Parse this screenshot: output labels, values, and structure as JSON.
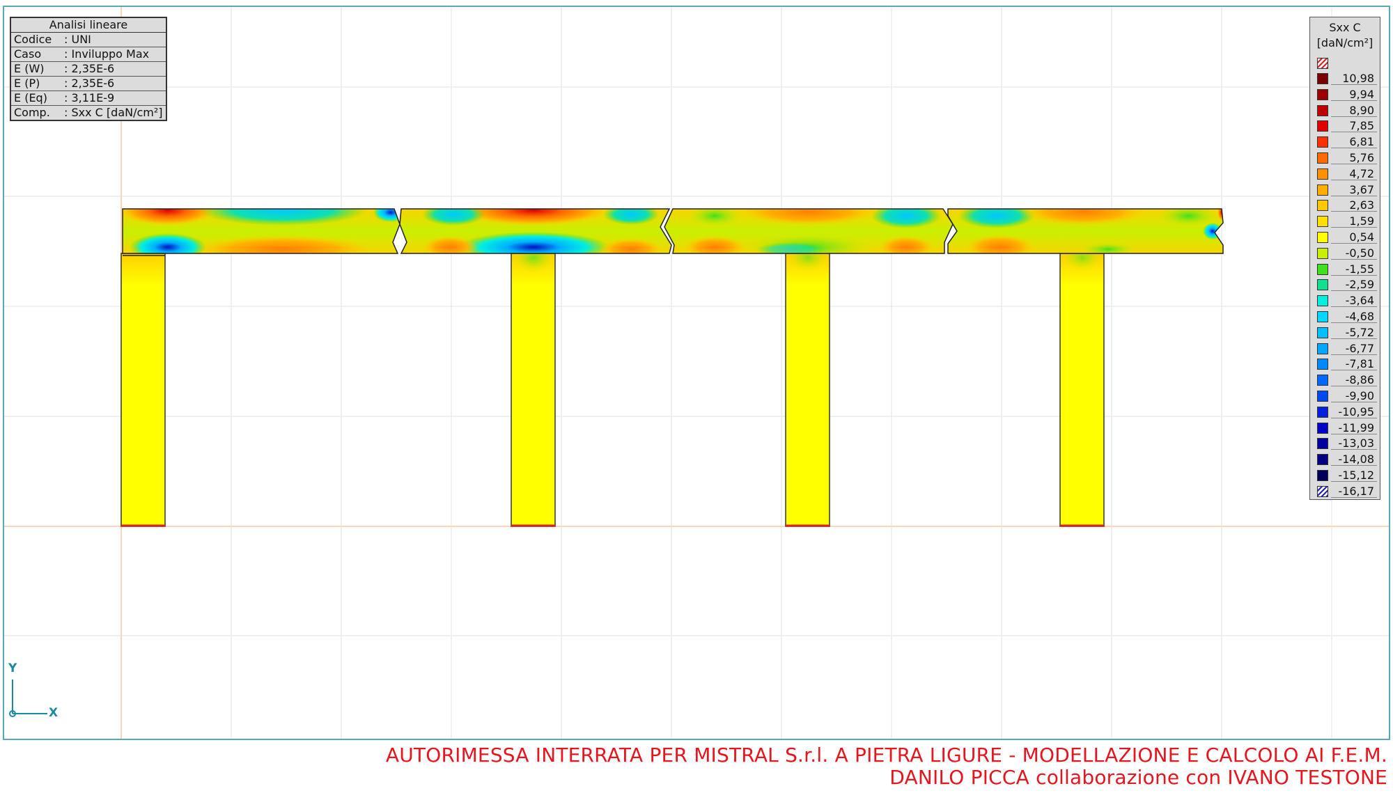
{
  "info_panel": {
    "title": "Analisi lineare",
    "rows": [
      {
        "key": "Codice",
        "value": ": UNI"
      },
      {
        "key": "Caso",
        "value": ": Inviluppo Max"
      },
      {
        "key": "E (W)",
        "value": ": 2,35E-6"
      },
      {
        "key": "E (P)",
        "value": ": 2,35E-6"
      },
      {
        "key": "E (Eq)",
        "value": ": 3,11E-9"
      },
      {
        "key": "Comp.",
        "value": ": Sxx C [daN/cm²]"
      }
    ]
  },
  "legend": {
    "title": "Sxx C",
    "unit": "[daN/cm²]",
    "entries": [
      {
        "label": "10,98",
        "color": "#7a0000"
      },
      {
        "label": "9,94",
        "color": "#9e0000"
      },
      {
        "label": "8,90",
        "color": "#c00000"
      },
      {
        "label": "7,85",
        "color": "#e00000"
      },
      {
        "label": "6,81",
        "color": "#ff3000"
      },
      {
        "label": "5,76",
        "color": "#ff6a00"
      },
      {
        "label": "4,72",
        "color": "#ff9000"
      },
      {
        "label": "3,67",
        "color": "#ffae00"
      },
      {
        "label": "2,63",
        "color": "#ffc800"
      },
      {
        "label": "1,59",
        "color": "#ffe000"
      },
      {
        "label": "0,54",
        "color": "#ffff00"
      },
      {
        "label": "-0,50",
        "color": "#c8f000"
      },
      {
        "label": "-1,55",
        "color": "#40e020"
      },
      {
        "label": "-2,59",
        "color": "#10e090"
      },
      {
        "label": "-3,64",
        "color": "#00f0e0"
      },
      {
        "label": "-4,68",
        "color": "#00d8ff"
      },
      {
        "label": "-5,72",
        "color": "#00c0ff"
      },
      {
        "label": "-6,77",
        "color": "#00a8ff"
      },
      {
        "label": "-7,81",
        "color": "#0088ff"
      },
      {
        "label": "-8,86",
        "color": "#0068ff"
      },
      {
        "label": "-9,90",
        "color": "#0048f0"
      },
      {
        "label": "-10,95",
        "color": "#0020e0"
      },
      {
        "label": "-11,99",
        "color": "#0000c8"
      },
      {
        "label": "-13,03",
        "color": "#0000a0"
      },
      {
        "label": "-14,08",
        "color": "#000080"
      },
      {
        "label": "-15,12",
        "color": "#000058"
      },
      {
        "label": "-16,17",
        "color": "#ffffff"
      }
    ]
  },
  "axes": {
    "x_label": "X",
    "y_label": "Y"
  },
  "footer": {
    "line1": "AUTORIMESSA INTERRATA PER MISTRAL S.r.l. A PIETRA LIGURE - MODELLAZIONE E CALCOLO AI F.E.M.",
    "line2": "DANILO PICCA collaborazione con IVANO TESTONE"
  },
  "colors": {
    "accent_frame": "#5aaab4",
    "footer_text": "#e8141e",
    "axis": "#1a8aa0"
  }
}
